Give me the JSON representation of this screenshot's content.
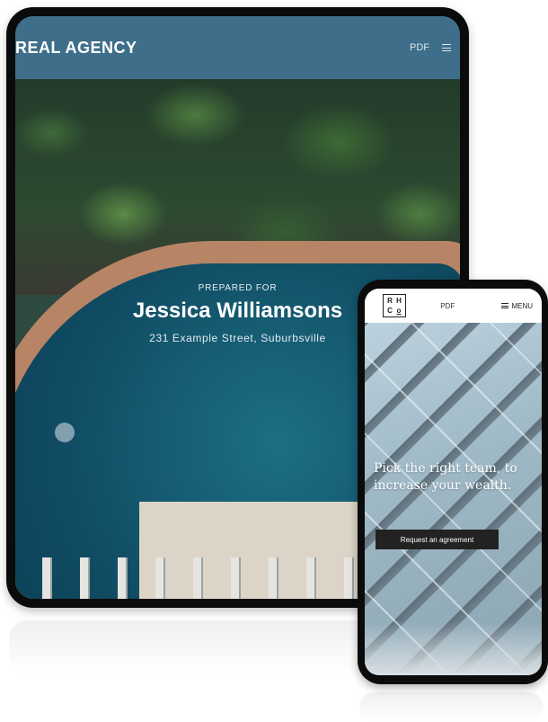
{
  "tablet": {
    "brand": "REAL AGENCY",
    "pdf_label": "PDF",
    "hero": {
      "prepared_for": "PREPARED FOR",
      "client_name": "Jessica Williamsons",
      "address": "231 Example Street, Suburbsville"
    }
  },
  "phone": {
    "logo": [
      "R",
      "H",
      "C",
      "o"
    ],
    "pdf_label": "PDF",
    "menu_label": "MENU",
    "tagline": "Pick the right team, to increase your wealth.",
    "cta_label": "Request an agreement"
  },
  "icons": {
    "tablet_menu": "hamburger-icon",
    "phone_menu": "hamburger-icon"
  },
  "colors": {
    "tablet_header": "#3f6e8a",
    "cta_background": "#222222"
  }
}
